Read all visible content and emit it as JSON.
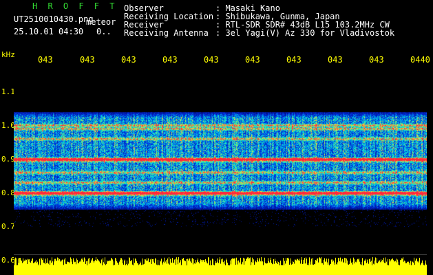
{
  "header": {
    "app_name": "H R O F F T",
    "file_name": "UT2510010430.png",
    "event_label": "meteor",
    "datetime": "25.10.01 04:30",
    "count": "0..",
    "fields": [
      {
        "label": "Observer",
        "value": ": Masaki Kano"
      },
      {
        "label": "Receiving Location",
        "value": ": Shibukawa, Gunma, Japan"
      },
      {
        "label": "Receiver",
        "value": ": RTL-SDR SDR# 43dB L15 103.2MHz CW"
      },
      {
        "label": "Receiving Antenna",
        "value": ": 3el Yagi(V) Az 330 for Vladivostok"
      }
    ]
  },
  "colors": {
    "background": "#000000",
    "axis_text": "#ffff00",
    "header_title": "#33dd33",
    "header_text": "#ffffff",
    "signal_low": "#0000aa",
    "signal_mid": "#00ccff",
    "signal_high": "#ff3333",
    "audio_bar": "#ffff00"
  },
  "chart_data": {
    "type": "heatmap",
    "ylabel": "kHz",
    "x_tick_labels": [
      "043",
      "043",
      "043",
      "043",
      "043",
      "043",
      "043",
      "043",
      "043",
      "0440"
    ],
    "y_tick_labels": [
      "1.1",
      "1.0",
      "0.9",
      "0.8",
      "0.7",
      "0.6"
    ],
    "y_ticks": [
      1.1,
      1.0,
      0.9,
      0.8,
      0.7,
      0.6
    ],
    "ylim": [
      0.6,
      1.14
    ],
    "noise_band_khz": [
      0.75,
      1.04
    ],
    "carrier_lines_khz": [
      1.0,
      0.99,
      0.9,
      0.895,
      0.8,
      0.795,
      0.96,
      0.86,
      0.83
    ],
    "strong_lines_khz": [
      0.9,
      0.8
    ],
    "x_range_minutes": [
      0,
      10
    ],
    "grid": false
  }
}
